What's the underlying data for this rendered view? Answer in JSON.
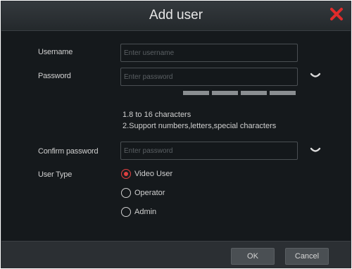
{
  "dialog": {
    "title": "Add user",
    "close_icon": "close-icon",
    "accent_color": "#e02b2b"
  },
  "form": {
    "username": {
      "label": "Username",
      "value": "",
      "placeholder": "Enter username"
    },
    "password": {
      "label": "Password",
      "value": "",
      "placeholder": "Enter password",
      "toggle_icon": "chevron-down-icon"
    },
    "password_strength": {
      "segments": 4
    },
    "hints": [
      "1.8 to 16 characters",
      "2.Support numbers,letters,special characters"
    ],
    "confirm_password": {
      "label": "Confirm password",
      "value": "",
      "placeholder": "Enter password",
      "toggle_icon": "chevron-down-icon"
    },
    "user_type": {
      "label": "User Type",
      "options": [
        {
          "label": "Video User",
          "selected": true
        },
        {
          "label": "Operator",
          "selected": false
        },
        {
          "label": "Admin",
          "selected": false
        }
      ]
    }
  },
  "footer": {
    "ok_label": "OK",
    "cancel_label": "Cancel"
  }
}
